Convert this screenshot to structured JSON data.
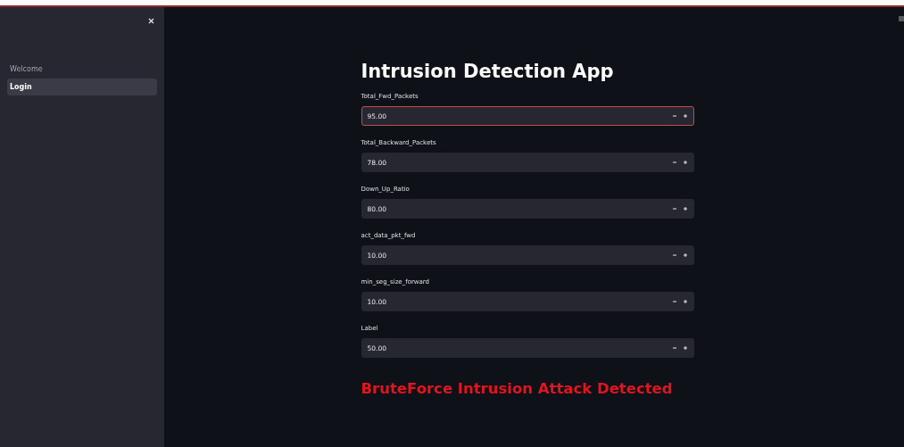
{
  "sidebar": {
    "items": [
      {
        "label": "Welcome",
        "selected": false
      },
      {
        "label": "Login",
        "selected": true
      }
    ]
  },
  "main": {
    "title": "Intrusion Detection App",
    "fields": [
      {
        "label": "Total_Fwd_Packets",
        "value": "95.00",
        "focused": true
      },
      {
        "label": "Total_Backward_Packets",
        "value": "78.00",
        "focused": false
      },
      {
        "label": "Down_Up_Ratio",
        "value": "80.00",
        "focused": false
      },
      {
        "label": "act_data_pkt_fwd",
        "value": "10.00",
        "focused": false
      },
      {
        "label": "min_seg_size_forward",
        "value": "10.00",
        "focused": false
      },
      {
        "label": "Label",
        "value": "50.00",
        "focused": false
      }
    ],
    "result": "BruteForce Intrusion Attack Detected"
  }
}
